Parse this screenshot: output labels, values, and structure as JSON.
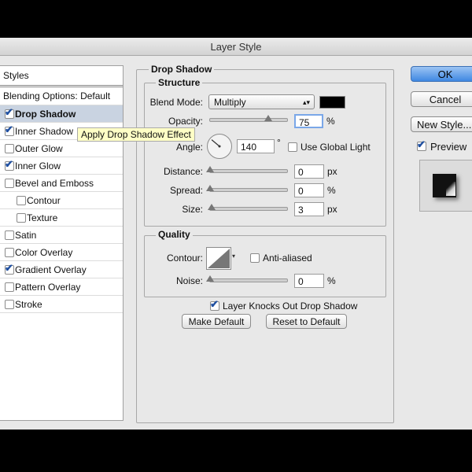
{
  "window": {
    "title": "Layer Style"
  },
  "styles_panel": {
    "header": "Styles",
    "blending_options": "Blending Options: Default",
    "items": [
      {
        "label": "Drop Shadow",
        "checked": true,
        "selected": true,
        "bold": true
      },
      {
        "label": "Inner Shadow",
        "checked": true
      },
      {
        "label": "Outer Glow",
        "checked": false
      },
      {
        "label": "Inner Glow",
        "checked": true
      },
      {
        "label": "Bevel and Emboss",
        "checked": false
      },
      {
        "label": "Contour",
        "checked": false,
        "indent": true
      },
      {
        "label": "Texture",
        "checked": false,
        "indent": true
      },
      {
        "label": "Satin",
        "checked": false
      },
      {
        "label": "Color Overlay",
        "checked": false
      },
      {
        "label": "Gradient Overlay",
        "checked": true
      },
      {
        "label": "Pattern Overlay",
        "checked": false
      },
      {
        "label": "Stroke",
        "checked": false
      }
    ]
  },
  "tooltip": {
    "text": "Apply Drop Shadow Effect"
  },
  "drop_shadow": {
    "title": "Drop Shadow",
    "structure": {
      "title": "Structure",
      "blend_mode_label": "Blend Mode:",
      "blend_mode_value": "Multiply",
      "blend_color": "#000000",
      "opacity_label": "Opacity:",
      "opacity_value": "75",
      "opacity_unit": "%",
      "opacity_level": 0.75,
      "angle_label": "Angle:",
      "angle_value": "140",
      "angle_unit": "°",
      "use_global_light_label": "Use Global Light",
      "use_global_light": false,
      "distance_label": "Distance:",
      "distance_value": "0",
      "distance_unit": "px",
      "spread_label": "Spread:",
      "spread_value": "0",
      "spread_unit": "%",
      "size_label": "Size:",
      "size_value": "3",
      "size_unit": "px"
    },
    "quality": {
      "title": "Quality",
      "contour_label": "Contour:",
      "anti_aliased_label": "Anti-aliased",
      "anti_aliased": false,
      "noise_label": "Noise:",
      "noise_value": "0",
      "noise_unit": "%"
    },
    "knocks_out_label": "Layer Knocks Out Drop Shadow",
    "knocks_out": true,
    "make_default_label": "Make Default",
    "reset_default_label": "Reset to Default"
  },
  "actions": {
    "ok_label": "OK",
    "cancel_label": "Cancel",
    "new_style_label": "New Style...",
    "preview_label": "Preview",
    "preview_checked": true
  }
}
